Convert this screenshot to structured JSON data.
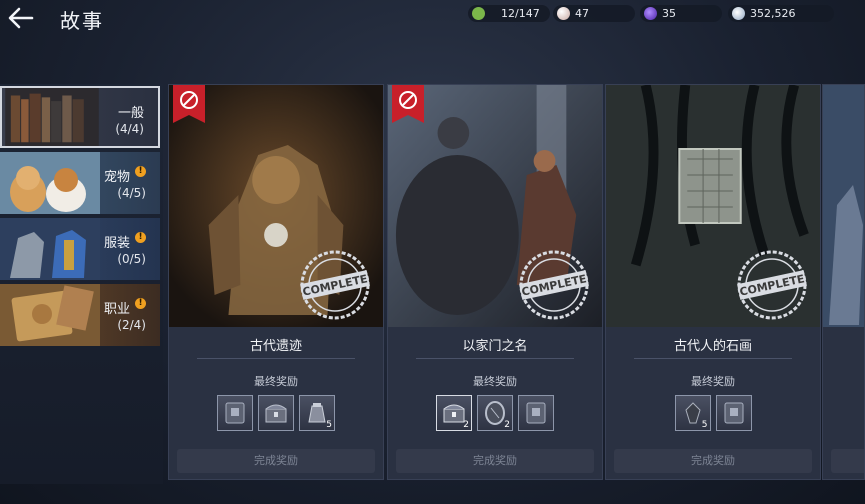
{
  "header": {
    "title": "故事",
    "currencies": [
      {
        "icon": "stamina-icon",
        "value": "12/147",
        "color": "#7bb64a"
      },
      {
        "icon": "pearl-icon",
        "value": "47",
        "color": "#e7d7d2"
      },
      {
        "icon": "purple-gem-icon",
        "value": "35",
        "color": "#7c4fd8"
      },
      {
        "icon": "silver-coin-icon",
        "value": "352,526",
        "color": "#c9d6e6"
      }
    ]
  },
  "sidebar": {
    "items": [
      {
        "label": "一般",
        "count": "(4/4)",
        "active": true,
        "alert": false
      },
      {
        "label": "宠物",
        "count": "(4/5)",
        "active": false,
        "alert": true
      },
      {
        "label": "服装",
        "count": "(0/5)",
        "active": false,
        "alert": true
      },
      {
        "label": "职业",
        "count": "(2/4)",
        "active": false,
        "alert": true
      }
    ],
    "alert_glyph": "!"
  },
  "cards": [
    {
      "title": "古代遗迹",
      "reward_label": "最终奖励",
      "button": "完成奖励",
      "stamp": "COMPLETE",
      "rewards": [
        {
          "icon": "book-icon",
          "qty": ""
        },
        {
          "icon": "chest-icon",
          "qty": ""
        },
        {
          "icon": "pouch-icon",
          "qty": "5"
        }
      ]
    },
    {
      "title": "以家门之名",
      "reward_label": "最终奖励",
      "button": "完成奖励",
      "stamp": "COMPLETE",
      "rewards": [
        {
          "icon": "chest-icon",
          "qty": "2"
        },
        {
          "icon": "shield-stone-icon",
          "qty": "2"
        },
        {
          "icon": "book-icon",
          "qty": ""
        }
      ]
    },
    {
      "title": "古代人的石画",
      "reward_label": "最终奖励",
      "button": "完成奖励",
      "stamp": "COMPLETE",
      "rewards": [
        {
          "icon": "crystal-icon",
          "qty": "5"
        },
        {
          "icon": "book-icon",
          "qty": ""
        }
      ]
    }
  ],
  "colors": {
    "accent_red": "#c8202a",
    "alert_orange": "#f0a020"
  }
}
